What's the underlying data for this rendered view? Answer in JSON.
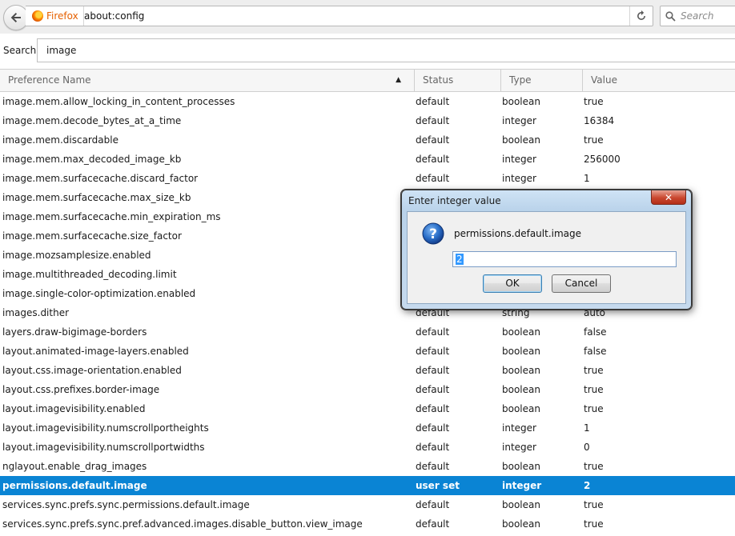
{
  "toolbar": {
    "identity_label": "Firefox",
    "url": "about:config",
    "search_placeholder": "Search"
  },
  "filter": {
    "label": "Search:",
    "value": "image"
  },
  "table": {
    "columns": [
      "Preference Name",
      "Status",
      "Type",
      "Value"
    ],
    "sort_indicator": "▲",
    "rows": [
      {
        "name": "image.mem.allow_locking_in_content_processes",
        "status": "default",
        "type": "boolean",
        "value": "true"
      },
      {
        "name": "image.mem.decode_bytes_at_a_time",
        "status": "default",
        "type": "integer",
        "value": "16384"
      },
      {
        "name": "image.mem.discardable",
        "status": "default",
        "type": "boolean",
        "value": "true"
      },
      {
        "name": "image.mem.max_decoded_image_kb",
        "status": "default",
        "type": "integer",
        "value": "256000"
      },
      {
        "name": "image.mem.surfacecache.discard_factor",
        "status": "default",
        "type": "integer",
        "value": "1"
      },
      {
        "name": "image.mem.surfacecache.max_size_kb",
        "status": "",
        "type": "",
        "value": ""
      },
      {
        "name": "image.mem.surfacecache.min_expiration_ms",
        "status": "",
        "type": "",
        "value": ""
      },
      {
        "name": "image.mem.surfacecache.size_factor",
        "status": "",
        "type": "",
        "value": ""
      },
      {
        "name": "image.mozsamplesize.enabled",
        "status": "",
        "type": "",
        "value": ""
      },
      {
        "name": "image.multithreaded_decoding.limit",
        "status": "",
        "type": "",
        "value": ""
      },
      {
        "name": "image.single-color-optimization.enabled",
        "status": "",
        "type": "",
        "value": ""
      },
      {
        "name": "images.dither",
        "status": "default",
        "type": "string",
        "value": "auto"
      },
      {
        "name": "layers.draw-bigimage-borders",
        "status": "default",
        "type": "boolean",
        "value": "false"
      },
      {
        "name": "layout.animated-image-layers.enabled",
        "status": "default",
        "type": "boolean",
        "value": "false"
      },
      {
        "name": "layout.css.image-orientation.enabled",
        "status": "default",
        "type": "boolean",
        "value": "true"
      },
      {
        "name": "layout.css.prefixes.border-image",
        "status": "default",
        "type": "boolean",
        "value": "true"
      },
      {
        "name": "layout.imagevisibility.enabled",
        "status": "default",
        "type": "boolean",
        "value": "true"
      },
      {
        "name": "layout.imagevisibility.numscrollportheights",
        "status": "default",
        "type": "integer",
        "value": "1"
      },
      {
        "name": "layout.imagevisibility.numscrollportwidths",
        "status": "default",
        "type": "integer",
        "value": "0"
      },
      {
        "name": "nglayout.enable_drag_images",
        "status": "default",
        "type": "boolean",
        "value": "true"
      },
      {
        "name": "permissions.default.image",
        "status": "user set",
        "type": "integer",
        "value": "2",
        "selected": true
      },
      {
        "name": "services.sync.prefs.sync.permissions.default.image",
        "status": "default",
        "type": "boolean",
        "value": "true"
      },
      {
        "name": "services.sync.prefs.sync.pref.advanced.images.disable_button.view_image",
        "status": "default",
        "type": "boolean",
        "value": "true"
      }
    ]
  },
  "dialog": {
    "title": "Enter integer value",
    "close_label": "✕",
    "message": "permissions.default.image",
    "input_value": "2",
    "ok_label": "OK",
    "cancel_label": "Cancel",
    "icon": "question-icon"
  },
  "colors": {
    "selected_row": "#0a84d4",
    "firefox_orange": "#e66000"
  }
}
